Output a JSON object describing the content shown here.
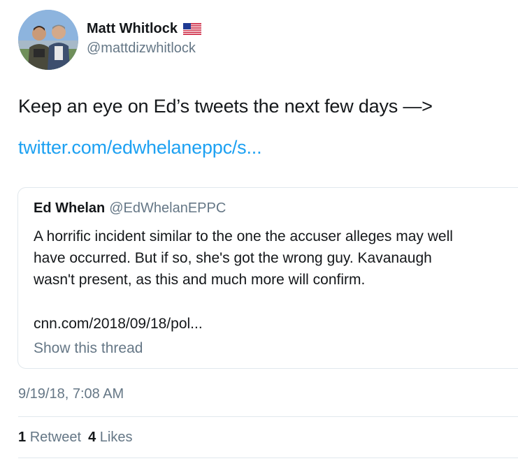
{
  "user": {
    "display_name": "Matt Whitlock",
    "handle": "@mattdizwhitlock",
    "flag_icon": "us-flag-icon"
  },
  "tweet": {
    "text": "Keep an eye on Ed’s tweets the next few days —>",
    "link": "twitter.com/edwhelaneppc/s..."
  },
  "quoted_tweet": {
    "display_name": "Ed Whelan",
    "handle": "@EdWhelanEPPC",
    "lines": [
      "A horrific incident similar to the one the accuser alleges may well",
      "have occurred. But if so, she's got the wrong guy. Kavanaugh",
      "wasn't present, as this and much more will confirm."
    ],
    "link": "cnn.com/2018/09/18/pol...",
    "show_thread": "Show this thread"
  },
  "timestamp": "9/19/18, 7:08 AM",
  "stats": {
    "retweets_count": "1",
    "retweets_label": "Retweet",
    "likes_count": "4",
    "likes_label": "Likes"
  },
  "colors": {
    "link": "#1da1f2",
    "secondary_text": "#657786",
    "primary_text": "#14171a",
    "border": "#e1e8ed"
  }
}
